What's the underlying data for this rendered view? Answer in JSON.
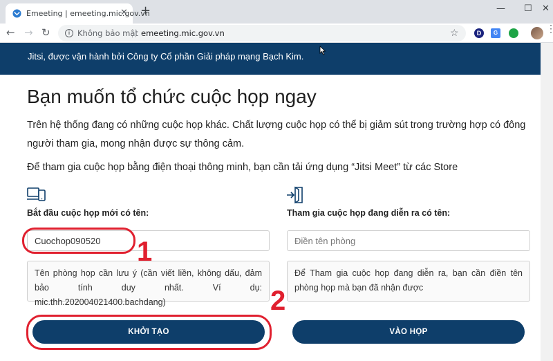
{
  "browser": {
    "tab_title": "Emeeting | emeeting.mic.gov.vn",
    "tab_close": "✕",
    "new_tab": "+",
    "window_minimize": "—",
    "window_maximize": "☐",
    "window_close": "✕",
    "not_secure": "Không bảo mật",
    "url": "emeeting.mic.gov.vn",
    "extensions": [
      {
        "name": "d-extension-icon",
        "color": "#1a237e",
        "label": "D"
      },
      {
        "name": "translate-extension-icon",
        "color": "#4285f4",
        "label": "G"
      },
      {
        "name": "green-extension-icon",
        "color": "#1ea446",
        "label": ""
      }
    ]
  },
  "banner": {
    "text": "Jitsi, được vận hành bởi Công ty Cổ phần Giải pháp mạng Bạch Kim."
  },
  "main": {
    "title": "Bạn muốn tổ chức cuộc họp ngay",
    "notice": "Trên hệ thống đang có những cuộc họp khác. Chất lượng cuộc họp có thể bị giảm sút trong trường hợp có đông người tham gia, mong nhận được sự thông cảm.",
    "mobile_note": "Để tham gia cuộc họp bằng điện thoại thông minh, bạn cần tải ứng dụng “Jitsi Meet” từ các Store"
  },
  "create": {
    "label": "Bắt đầu cuộc họp mới có tên:",
    "value": "Cuochop090520",
    "note": "Tên phòng họp cần lưu ý (cần viết liền, không dấu, đảm bảo tính duy nhất. Ví dụ: mic.thh.202004021400.bachdang)",
    "button": "KHỞI TẠO"
  },
  "join": {
    "label": "Tham gia cuộc họp đang diễn ra có tên:",
    "placeholder": "Điền tên phòng",
    "note": "Để Tham gia cuộc họp đang diễn ra, bạn cần điền tên phòng họp mà bạn đã nhận được",
    "button": "VÀO HỌP"
  },
  "annotations": {
    "step1": "1",
    "step2": "2",
    "color": "#e0202f"
  },
  "colors": {
    "brand": "#0e3e6a"
  }
}
